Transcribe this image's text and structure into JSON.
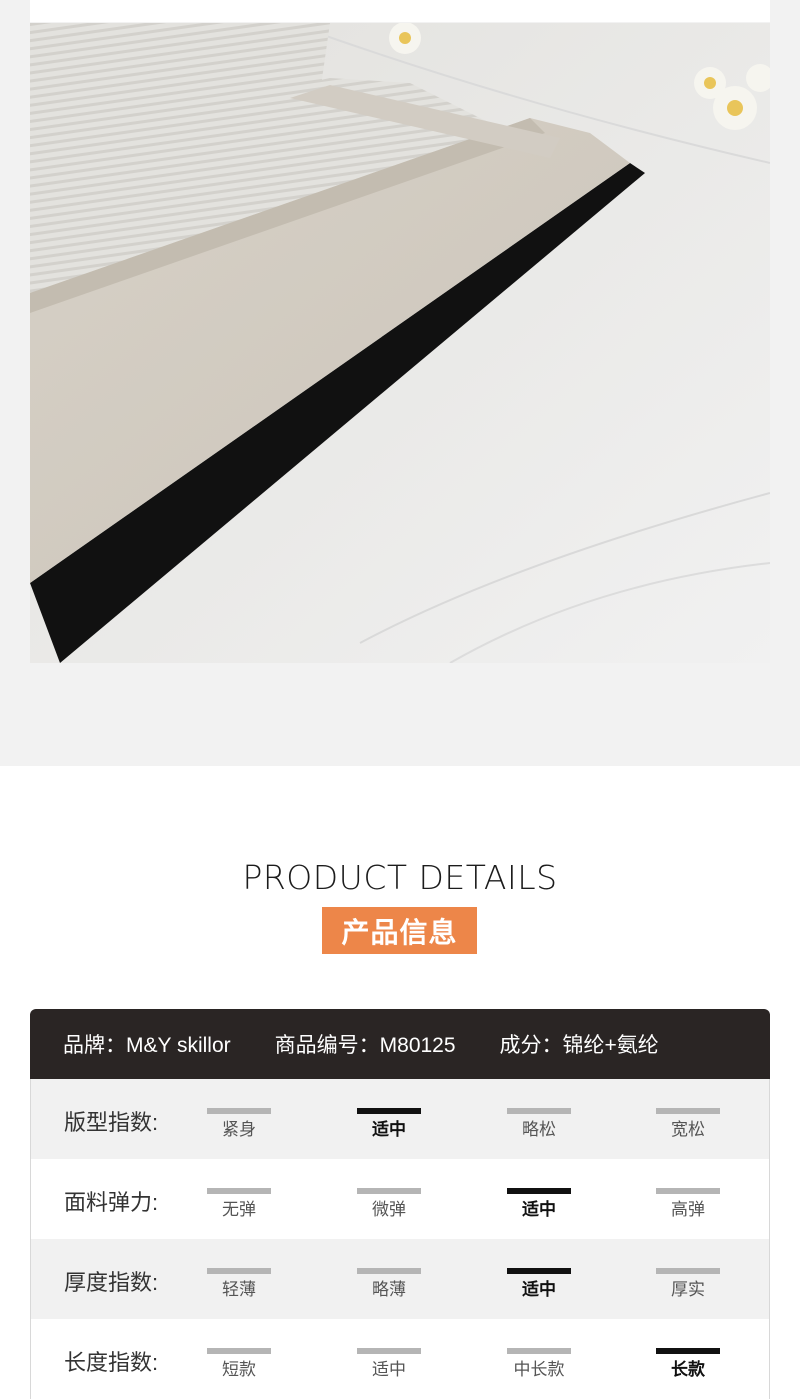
{
  "section": {
    "title_en": "PRODUCT DETAILS",
    "title_cn": "产品信息"
  },
  "info": {
    "brand": "品牌：M&Y skillor",
    "code": "商品编号：M80125",
    "composition": "成分：锦纶+氨纶"
  },
  "indices": [
    {
      "label": "版型指数:",
      "options": [
        "紧身",
        "适中",
        "略松",
        "宽松"
      ],
      "selected": 1
    },
    {
      "label": "面料弹力:",
      "options": [
        "无弹",
        "微弹",
        "适中",
        "高弹"
      ],
      "selected": 2
    },
    {
      "label": "厚度指数:",
      "options": [
        "轻薄",
        "略薄",
        "适中",
        "厚实"
      ],
      "selected": 2
    },
    {
      "label": "长度指数:",
      "options": [
        "短款",
        "适中",
        "中长款",
        "长款"
      ],
      "selected": 3
    }
  ],
  "colors": {
    "accent": "#ed8649",
    "info_bar": "#2a2524",
    "selected_bar": "#111111",
    "unselected_bar": "#b5b5b5"
  }
}
